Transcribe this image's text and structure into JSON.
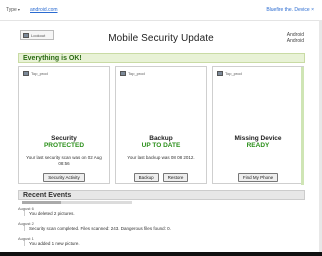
{
  "topbar": {
    "type_label": "Type",
    "type_caret": "▾",
    "account": "android.com",
    "right_link": "Bluefire the. Device ×"
  },
  "header": {
    "logo_text": "Lookout",
    "title": "Mobile Security Update",
    "device_line1": "Android",
    "device_line2": "Android"
  },
  "status_bar": "Everything is OK!",
  "cards": [
    {
      "top_label": "Top_prod",
      "heading": "Security",
      "status": "PROTECTED",
      "detail": "Your last security scan was on 02 Aug 08:56",
      "buttons": [
        "Security Activity"
      ]
    },
    {
      "top_label": "Top_prod",
      "heading": "Backup",
      "status": "UP TO DATE",
      "detail": "Your last backup was 08 08 2012.",
      "buttons": [
        "Backup",
        "Restore"
      ]
    },
    {
      "top_label": "Top_prod",
      "heading": "Missing Device",
      "status": "READY",
      "detail": "",
      "buttons": [
        "Find My Phone"
      ]
    }
  ],
  "recent": {
    "title": "Recent Events",
    "progress_fraction": 0.35,
    "events": [
      {
        "date": "August 6",
        "text": "You deleted 2 pictures."
      },
      {
        "date": "August 2",
        "text": "Security scan completed. Files scanned: 243. Dangerous files found: 0."
      },
      {
        "date": "August 1",
        "text": "You added 1 new picture."
      }
    ]
  }
}
